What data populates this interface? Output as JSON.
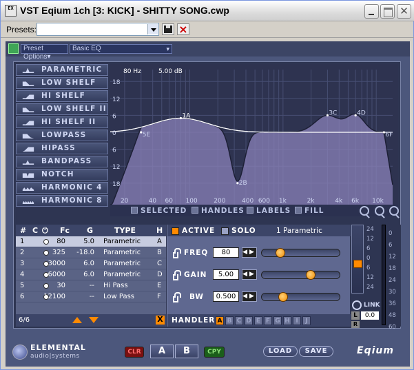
{
  "window": {
    "title": "VST Eqium 1ch [3: KICK] - SHITTY SONG.cwp",
    "icon_text": "EX"
  },
  "presets": {
    "label": "Presets:",
    "value": ""
  },
  "toolbar": {
    "preset_options": "Preset Options▾",
    "basic_eq": "Basic EQ"
  },
  "filter_types": [
    "PARAMETRIC",
    "LOW SHELF",
    "HI SHELF",
    "LOW SHELF II",
    "HI SHELF II",
    "LOWPASS",
    "HIPASS",
    "BANDPASS",
    "NOTCH",
    "HARMONIC 4",
    "HARMONIC 8"
  ],
  "graph": {
    "freq_readout": "80 Hz",
    "gain_readout": "5.00 dB",
    "db_labels": [
      "18",
      "12",
      "6",
      "0",
      "6",
      "12",
      "18"
    ],
    "freq_labels": [
      "20",
      "40",
      "60",
      "100",
      "200",
      "400",
      "600",
      "1k",
      "2k",
      "4k",
      "6k",
      "10k"
    ],
    "node_labels": [
      "1A",
      "2B",
      "3C",
      "4D",
      "5E",
      "6F"
    ],
    "checks": {
      "selected": "SELECTED",
      "handles": "HANDLES",
      "labels": "LABELS",
      "fill": "FILL"
    }
  },
  "table": {
    "headers": {
      "num": "#",
      "c": "C",
      "power": "⏻",
      "fc": "Fc",
      "g": "G",
      "type": "TYPE",
      "h": "H"
    },
    "rows": [
      {
        "num": "1",
        "fc": "80",
        "g": "5.0",
        "type": "Parametric",
        "h": "A"
      },
      {
        "num": "2",
        "fc": "325",
        "g": "-18.0",
        "type": "Parametric",
        "h": "B"
      },
      {
        "num": "3",
        "fc": "3000",
        "g": "6.0",
        "type": "Parametric",
        "h": "C"
      },
      {
        "num": "4",
        "fc": "6000",
        "g": "6.0",
        "type": "Parametric",
        "h": "D"
      },
      {
        "num": "5",
        "fc": "30",
        "g": "--",
        "type": "Hi Pass",
        "h": "E"
      },
      {
        "num": "6",
        "fc": "12100",
        "g": "--",
        "type": "Low Pass",
        "h": "F"
      }
    ],
    "count": "6/6",
    "close": "X"
  },
  "controls": {
    "active": "ACTIVE",
    "solo": "SOLO",
    "selected": "1 Parametric",
    "freq_label": "FREQ",
    "freq_value": "80",
    "gain_label": "GAIN",
    "gain_value": "5.00",
    "bw_label": "BW",
    "bw_value": "0.500",
    "handler_label": "HANDLER",
    "handlers": [
      "A",
      "B",
      "C",
      "D",
      "E",
      "F",
      "G",
      "H",
      "I",
      "J"
    ]
  },
  "master": {
    "fader_ticks": [
      "24",
      "12",
      "6",
      "0",
      "6",
      "12",
      "24"
    ],
    "meter_ticks": [
      "0",
      "6",
      "12",
      "18",
      "24",
      "30",
      "36",
      "48",
      "60"
    ],
    "link": "LINK",
    "left": "L",
    "right": "R",
    "value": "0.0"
  },
  "footer": {
    "brand1": "ELEMENTAL",
    "brand2": "audio|systems",
    "clr": "CLR",
    "a": "A",
    "b": "B",
    "cpy": "CPY",
    "load": "LOAD",
    "save": "SAVE",
    "product": "Eqium"
  },
  "colors": {
    "accent": "#ff8a00",
    "panel": "#4c577c",
    "curve_fill": "#8a82b8"
  }
}
